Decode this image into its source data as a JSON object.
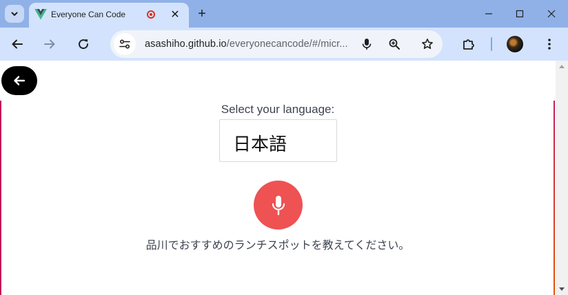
{
  "browser": {
    "tab": {
      "title": "Everyone Can Code",
      "close_label": "✕"
    },
    "new_tab_label": "+",
    "address": {
      "host": "asashiho.github.io",
      "path": "/everyonecancode/#/micr..."
    }
  },
  "page": {
    "language_label": "Select your language:",
    "selected_language": "日本語",
    "transcript": "品川でおすすめのランチスポットを教えてください。"
  },
  "colors": {
    "mic_button": "#ee5253",
    "toolbar": "#d3e3fd",
    "titlebar": "#8fb1e8"
  }
}
